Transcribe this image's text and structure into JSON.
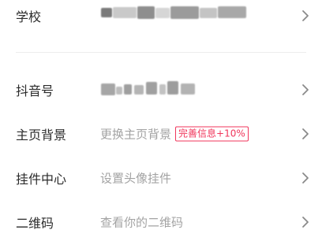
{
  "rows": [
    {
      "label": "学校",
      "value": ""
    },
    {
      "label": "抖音号",
      "value": ""
    },
    {
      "label": "主页背景",
      "value": "更换主页背景",
      "badge": "完善信息+10%"
    },
    {
      "label": "挂件中心",
      "value": "设置头像挂件"
    },
    {
      "label": "二维码",
      "value": "查看你的二维码"
    }
  ],
  "colors": {
    "label": "#2b2b2b",
    "value": "#a3a3a3",
    "badge": "#f0365b",
    "chevron": "#8a8a8a",
    "divider": "#ededed"
  },
  "icons": {
    "chevron": "chevron-right-icon"
  }
}
